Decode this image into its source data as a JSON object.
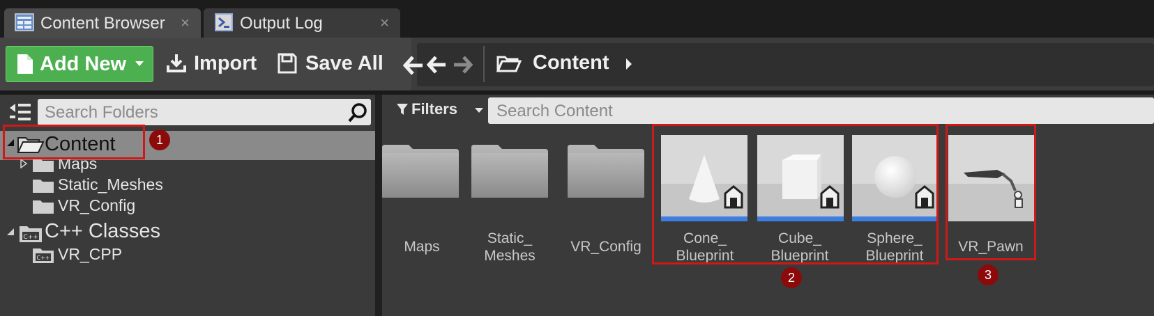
{
  "tabs": [
    {
      "label": "Content Browser",
      "close": "×",
      "icon": "content-browser-icon"
    },
    {
      "label": "Output Log",
      "close": "×",
      "icon": "output-log-icon"
    }
  ],
  "toolbar": {
    "add_new_label": "Add New",
    "import_label": "Import",
    "save_all_label": "Save All",
    "breadcrumb": "Content",
    "accent_color": "#4caf50"
  },
  "folders": {
    "search_placeholder": "Search Folders",
    "tree": [
      {
        "label": "Content"
      },
      {
        "label": "Maps"
      },
      {
        "label": "Static_Meshes"
      },
      {
        "label": "VR_Config"
      },
      {
        "label": "C++ Classes"
      },
      {
        "label": "VR_CPP"
      }
    ]
  },
  "content": {
    "filters_label": "Filters",
    "search_placeholder": "Search Content",
    "items": [
      {
        "label": "Maps",
        "type": "folder"
      },
      {
        "label": "Static_ Meshes",
        "type": "folder"
      },
      {
        "label": "VR_Config",
        "type": "folder"
      },
      {
        "label": "Cone_ Blueprint",
        "type": "blueprint",
        "thumb": "cone"
      },
      {
        "label": "Cube_ Blueprint",
        "type": "blueprint",
        "thumb": "cube"
      },
      {
        "label": "Sphere_ Blueprint",
        "type": "blueprint",
        "thumb": "sphere"
      },
      {
        "label": "VR_Pawn",
        "type": "blueprint",
        "thumb": "pawn"
      }
    ]
  },
  "annotations": [
    {
      "number": "1"
    },
    {
      "number": "2"
    },
    {
      "number": "3"
    }
  ]
}
